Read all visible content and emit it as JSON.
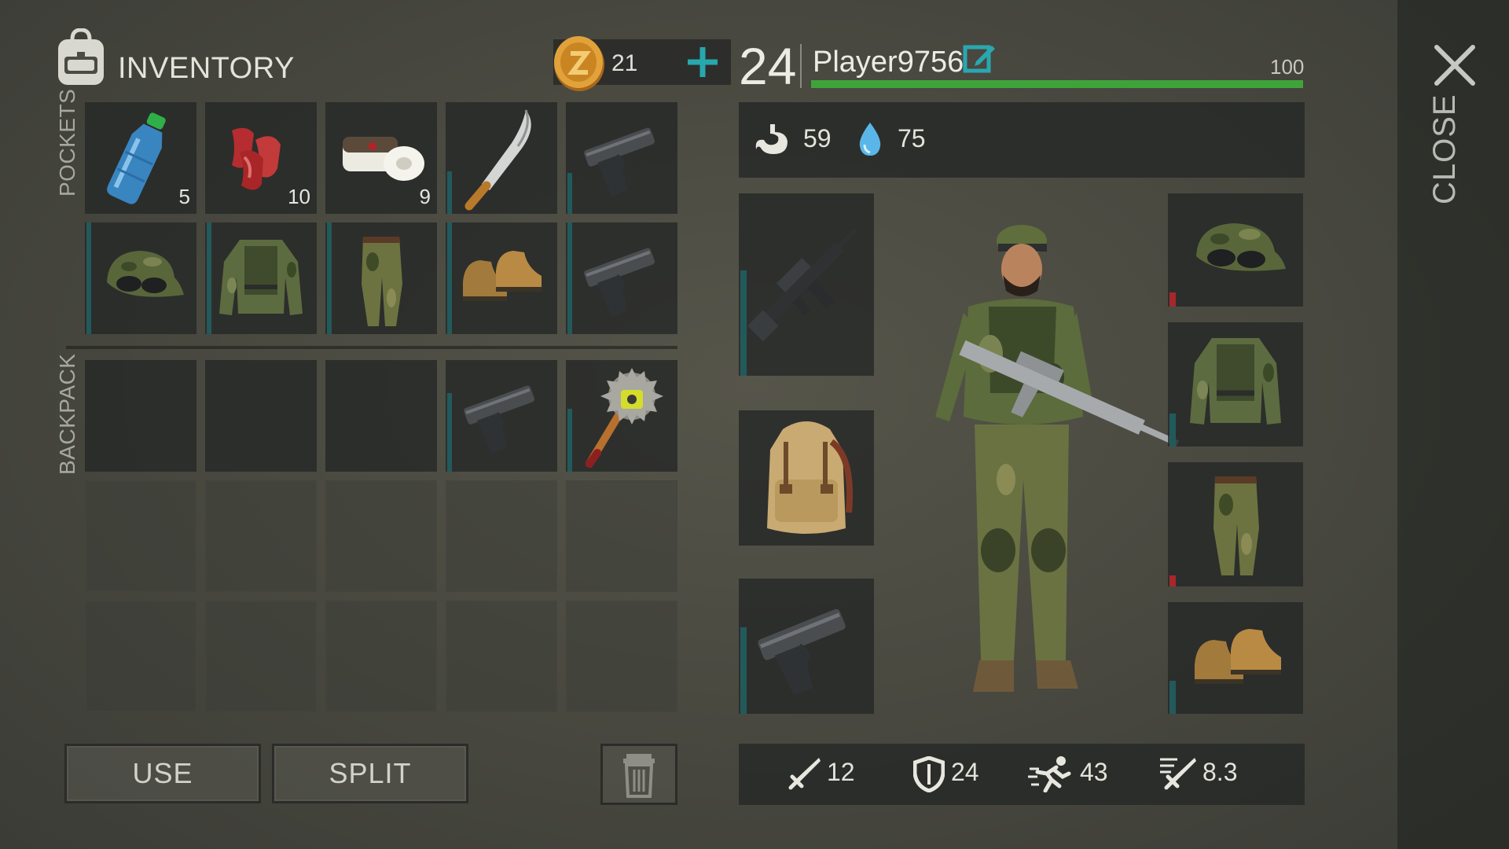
{
  "inventory": {
    "title": "INVENTORY",
    "coins": "21",
    "pockets_label": "POCKETS",
    "backpack_label": "BACKPACK",
    "pocket_items": [
      {
        "name": "water-bottle",
        "qty": "5"
      },
      {
        "name": "raw-meat",
        "qty": "10"
      },
      {
        "name": "bandage",
        "qty": "9"
      },
      {
        "name": "machete",
        "qty": ""
      },
      {
        "name": "pistol",
        "qty": ""
      },
      {
        "name": "camo-cap",
        "qty": ""
      },
      {
        "name": "camo-jacket",
        "qty": ""
      },
      {
        "name": "camo-pants",
        "qty": ""
      },
      {
        "name": "boots",
        "qty": ""
      },
      {
        "name": "pistol",
        "qty": ""
      }
    ],
    "backpack_items": [
      {
        "name": "",
        "qty": ""
      },
      {
        "name": "",
        "qty": ""
      },
      {
        "name": "",
        "qty": ""
      },
      {
        "name": "pistol",
        "qty": ""
      },
      {
        "name": "spiked-club",
        "qty": ""
      }
    ]
  },
  "actions": {
    "use_label": "USE",
    "split_label": "SPLIT",
    "trash_icon": "trash-icon"
  },
  "player": {
    "level": "24",
    "name": "Player9756",
    "health": "100",
    "health_fraction": 1.0,
    "hunger": "59",
    "thirst": "75"
  },
  "equipment": {
    "left": [
      "assault-rifle",
      "backpack",
      "pistol"
    ],
    "right": [
      "camo-cap",
      "camo-jacket",
      "camo-pants",
      "boots"
    ]
  },
  "combat_stats": {
    "damage": "12",
    "defense": "24",
    "speed": "43",
    "attack_speed": "8.3"
  },
  "close_label": "CLOSE",
  "colors": {
    "health_bar": "#3ea43a",
    "durability_bar": "#225a5c",
    "low_durability": "#a8272a",
    "accent_teal": "#2aa7b0"
  }
}
